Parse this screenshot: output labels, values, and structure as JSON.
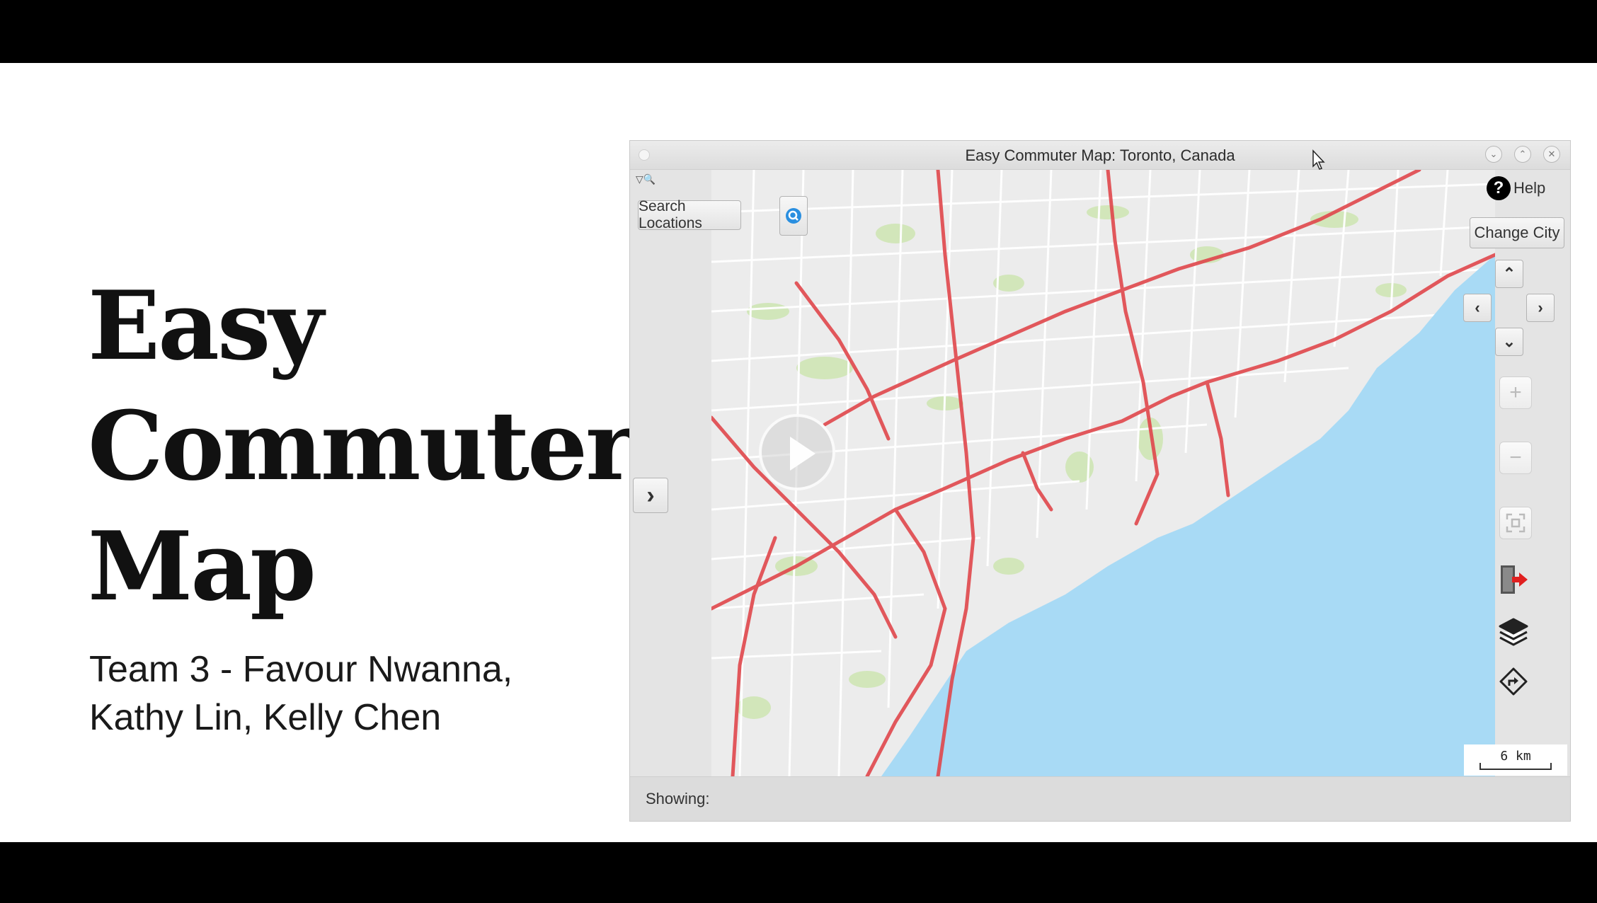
{
  "slide": {
    "title_lines": [
      "Easy",
      "Commuter",
      "Map"
    ],
    "subtitle_lines": [
      "Team 3 - Favour Nwanna,",
      "Kathy Lin, Kelly Chen"
    ]
  },
  "window": {
    "title": "Easy Commuter Map: Toronto, Canada",
    "controls": {
      "minimize": "⌄",
      "maximize": "⌃",
      "close": "✕"
    }
  },
  "toolbar": {
    "search_label": "Search Locations",
    "search_icon": "search-icon",
    "help_label": "Help",
    "help_symbol": "?",
    "change_city_label": "Change City"
  },
  "navigation": {
    "up": "⌃",
    "left": "‹",
    "right": "›",
    "down": "⌄",
    "expand_panel": "›"
  },
  "tools": {
    "zoom_in": "+",
    "zoom_out": "−",
    "icons": [
      "zoom-in-icon",
      "zoom-out-icon",
      "fit-view-icon",
      "exit-icon",
      "layers-icon",
      "directions-icon"
    ]
  },
  "map": {
    "scale_label": "6 km",
    "colors": {
      "water": "#a8daf5",
      "land": "#ececec",
      "park": "#cde8b0",
      "highway": "#e0474c",
      "street": "#ffffff"
    }
  },
  "status": {
    "label": "Showing:"
  }
}
